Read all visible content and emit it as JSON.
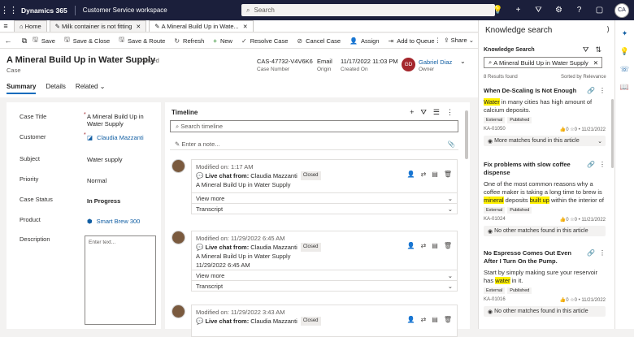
{
  "topbar": {
    "brand": "Dynamics 365",
    "app": "Customer Service workspace",
    "search_placeholder": "Search",
    "user_initials": "CA"
  },
  "tabs": [
    {
      "label": "Home"
    },
    {
      "label": "Milk container is not fitting"
    },
    {
      "label": "A Mineral Build Up in Wate..."
    }
  ],
  "commands": [
    {
      "label": "Save",
      "icon": "save-icon"
    },
    {
      "label": "Save & Close",
      "icon": "save-close-icon"
    },
    {
      "label": "Save & Route",
      "icon": "save-route-icon"
    },
    {
      "label": "Refresh",
      "icon": "refresh-icon"
    },
    {
      "label": "New",
      "icon": "plus-icon"
    },
    {
      "label": "Resolve Case",
      "icon": "resolve-icon"
    },
    {
      "label": "Cancel Case",
      "icon": "cancel-icon"
    },
    {
      "label": "Assign",
      "icon": "assign-icon"
    },
    {
      "label": "Add to Queue",
      "icon": "queue-icon"
    }
  ],
  "share_label": "Share",
  "header": {
    "title": "A Mineral Build Up in Water Supply",
    "saved": "- Saved",
    "entity": "Case",
    "case_number": "CAS-47732-V4V6K6",
    "case_number_label": "Case Number",
    "origin": "Email",
    "origin_label": "Origin",
    "created_on": "11/17/2022 11:03 PM",
    "created_on_label": "Created On",
    "owner_initials": "GD",
    "owner": "Gabriel Diaz",
    "owner_label": "Owner"
  },
  "form_tabs": [
    "Summary",
    "Details",
    "Related"
  ],
  "fields": {
    "case_title_label": "Case Title",
    "case_title": "A Mineral Build Up in Water Supply",
    "customer_label": "Customer",
    "customer": "Claudia Mazzanti",
    "subject_label": "Subject",
    "subject": "Water supply",
    "priority_label": "Priority",
    "priority": "Normal",
    "status_label": "Case Status",
    "status": "In Progress",
    "product_label": "Product",
    "product": "Smart Brew 300",
    "description_label": "Description",
    "description_placeholder": "Enter text..."
  },
  "timeline": {
    "title": "Timeline",
    "search_placeholder": "Search timeline",
    "note_placeholder": "Enter a note...",
    "entries": [
      {
        "modified": "Modified on: 1:17 AM",
        "type": "Live chat from:",
        "from": "Claudia Mazzanti",
        "status": "Closed",
        "subject": "A Mineral Build Up in Water Supply",
        "date": "",
        "more": "View more",
        "transcript": "Transcript"
      },
      {
        "modified": "Modified on: 11/29/2022 6:45 AM",
        "type": "Live chat from:",
        "from": "Claudia Mazzanti",
        "status": "Closed",
        "subject": "A Mineral Build Up in Water Supply",
        "date": "11/29/2022 6:45 AM",
        "more": "View more",
        "transcript": "Transcript"
      },
      {
        "modified": "Modified on: 11/29/2022 3:43 AM",
        "type": "Live chat from:",
        "from": "Claudia Mazzanti",
        "status": "Closed"
      }
    ]
  },
  "knowledge": {
    "panel_title": "Knowledge search",
    "section_label": "Knowledge Search",
    "query": "A Mineral Build Up in Water Supply",
    "results_count": "8 Results found",
    "sorted": "Sorted by Relevance",
    "articles": [
      {
        "title": "When De-Scaling Is Not Enough",
        "body_pre": "",
        "highlight": "Water",
        "body_post": " in many cities has high amount of calcium deposits.",
        "tags": [
          "External",
          "Published"
        ],
        "id": "KA-01050",
        "views": "0",
        "rating": "0",
        "date": "11/21/2022",
        "match": "More matches found in this article"
      },
      {
        "title": "Fix problems with slow coffee dispense",
        "body_pre": "One of the most common reasons why a coffee maker is taking a long time to brew is ",
        "highlight": "mineral",
        "body_mid": " deposits ",
        "highlight2": "built up",
        "body_post": " within the interior of the machi...",
        "tags": [
          "External",
          "Published"
        ],
        "id": "KA-01024",
        "views": "0",
        "rating": "0",
        "date": "11/21/2022",
        "match": "No other matches found in this article"
      },
      {
        "title": "No Espresso Comes Out Even After I Turn On the Pump.",
        "body_pre": "Start by simply making sure your reservoir has ",
        "highlight": "water",
        "body_post": " in it.",
        "tags": [
          "External",
          "Published"
        ],
        "id": "KA-01016",
        "views": "0",
        "rating": "0",
        "date": "11/21/2022",
        "match": "No other matches found in this article"
      }
    ]
  }
}
